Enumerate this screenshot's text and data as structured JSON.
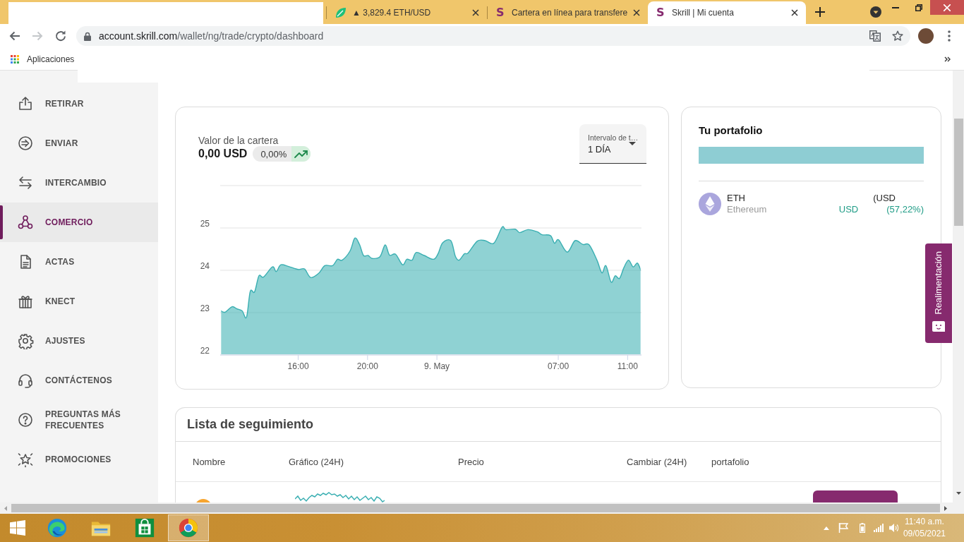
{
  "browser": {
    "tabs": [
      {
        "title": "▲ 3,829.4 ETH/USD",
        "selected": false
      },
      {
        "icon_letter": "S",
        "title": "Cartera en línea para transfere",
        "selected": false
      },
      {
        "icon_letter": "S",
        "title": "Skrill | Mi cuenta",
        "selected": true
      }
    ],
    "navigation": {
      "forward_disabled": true
    },
    "address": {
      "host": "account.skrill.com",
      "path": "/wallet/ng/trade/crypto/dashboard"
    },
    "bookmarks": [
      {
        "label": "Aplicaciones"
      }
    ]
  },
  "sidebar": {
    "items": [
      {
        "label": "RETIRAR",
        "selected": false
      },
      {
        "label": "ENVIAR",
        "selected": false
      },
      {
        "label": "INTERCAMBIO",
        "selected": false
      },
      {
        "label": "COMERCIO",
        "selected": true
      },
      {
        "label": "ACTAS",
        "selected": false
      },
      {
        "label": "KNECT",
        "selected": false
      },
      {
        "label": "AJUSTES",
        "selected": false
      },
      {
        "label": "CONTÁCTENOS",
        "selected": false
      },
      {
        "label": "PREGUNTAS MÁS FRECUENTES",
        "selected": false
      },
      {
        "label": "PROMOCIONES",
        "selected": false
      }
    ]
  },
  "portfolio_value": {
    "label": "Valor de la cartera",
    "amount": "0,00 USD",
    "change": "0,00%",
    "trend_up": true
  },
  "interval": {
    "label": "Intervalo de t…",
    "value": "1 DÍA"
  },
  "chart_data": {
    "type": "area",
    "grid": true,
    "x": [
      "2021-05-08T11:31",
      "2021-05-08T11:47",
      "2021-05-08T12:11",
      "2021-05-08T12:28",
      "2021-05-08T12:46",
      "2021-05-08T13:01",
      "2021-05-08T13:14",
      "2021-05-08T13:29",
      "2021-05-08T13:44",
      "2021-05-08T14:00",
      "2021-05-08T14:31",
      "2021-05-08T14:44",
      "2021-05-08T15:00",
      "2021-05-08T15:27",
      "2021-05-08T16:00",
      "2021-05-08T16:22",
      "2021-05-08T16:43",
      "2021-05-08T17:11",
      "2021-05-08T17:32",
      "2021-05-08T17:59",
      "2021-05-08T18:16",
      "2021-05-08T18:32",
      "2021-05-08T18:59",
      "2021-05-08T19:16",
      "2021-05-08T19:32",
      "2021-05-08T19:46",
      "2021-05-08T20:02",
      "2021-05-08T20:16",
      "2021-05-08T20:43",
      "2021-05-08T21:01",
      "2021-05-08T21:16",
      "2021-05-08T21:37",
      "2021-05-08T22:01",
      "2021-05-08T22:16",
      "2021-05-08T22:34",
      "2021-05-08T22:48",
      "2021-05-08T23:16",
      "2021-05-08T23:48",
      "2021-05-09T00:04",
      "2021-05-09T00:20",
      "2021-05-09T00:48",
      "2021-05-09T01:04",
      "2021-05-09T01:17",
      "2021-05-09T01:35",
      "2021-05-09T01:48",
      "2021-05-09T02:20",
      "2021-05-09T02:47",
      "2021-05-09T03:17",
      "2021-05-09T03:46",
      "2021-05-09T03:58",
      "2021-05-09T04:31",
      "2021-05-09T04:47",
      "2021-05-09T05:15",
      "2021-05-09T05:47",
      "2021-05-09T06:04",
      "2021-05-09T06:33",
      "2021-05-09T06:47",
      "2021-05-09T07:01",
      "2021-05-09T07:31",
      "2021-05-09T07:58",
      "2021-05-09T08:25",
      "2021-05-09T08:47",
      "2021-05-09T09:14",
      "2021-05-09T09:31",
      "2021-05-09T09:45",
      "2021-05-09T10:03",
      "2021-05-09T10:17",
      "2021-05-09T10:32",
      "2021-05-09T10:47",
      "2021-05-09T11:03",
      "2021-05-09T11:19",
      "2021-05-09T11:34",
      "2021-05-09T11:47"
    ],
    "series": [
      {
        "color": "#3aafb2",
        "values": [
          23.05,
          23.01,
          23.14,
          23.09,
          23.04,
          22.89,
          23.5,
          23.49,
          23.87,
          23.84,
          24.08,
          23.97,
          24.13,
          24.09,
          24.02,
          24.03,
          23.83,
          23.93,
          24.11,
          24.11,
          24.26,
          24.24,
          24.45,
          24.76,
          24.61,
          24.35,
          24.35,
          24.28,
          24.32,
          24.6,
          24.36,
          24.38,
          24.13,
          24.26,
          24.24,
          24.42,
          24.35,
          24.26,
          24.39,
          24.65,
          24.7,
          24.33,
          24.24,
          24.39,
          24.41,
          24.69,
          24.7,
          24.64,
          25.02,
          24.96,
          24.97,
          24.89,
          24.96,
          24.91,
          24.84,
          24.82,
          24.64,
          24.72,
          24.43,
          24.7,
          24.61,
          24.6,
          24.24,
          23.94,
          24.11,
          23.72,
          23.87,
          23.81,
          24.06,
          24.24,
          24.08,
          24.17,
          23.98
        ]
      }
    ],
    "xlim": [
      "2021-05-08T11:30",
      "2021-05-09T11:48"
    ],
    "ylim": [
      22,
      26
    ],
    "xticks": [
      {
        "value": "2021-05-08T16:00",
        "label": "16:00"
      },
      {
        "value": "2021-05-08T20:00",
        "label": "20:00"
      },
      {
        "value": "2021-05-09T00:00",
        "label": "9. May"
      },
      {
        "value": "2021-05-09T07:00",
        "label": "07:00"
      },
      {
        "value": "2021-05-09T11:00",
        "label": "11:00"
      }
    ],
    "yticks": [
      22,
      23,
      24,
      25
    ]
  },
  "portfolio": {
    "title": "Tu portafolio",
    "assets": [
      {
        "symbol": "ETH",
        "name": "Ethereum",
        "value": "(USD",
        "amount": "USD",
        "share": "(57,22%)"
      }
    ]
  },
  "feedback": {
    "label": "Realimentación"
  },
  "watchlist": {
    "title": "Lista de seguimiento",
    "columns": [
      "Nombre",
      "Gráfico (24H)",
      "Precio",
      "Cambiar (24H)",
      "portafolio"
    ]
  },
  "taskbar": {
    "apps": [
      {
        "selected": false
      },
      {
        "selected": false
      },
      {
        "selected": false
      },
      {
        "selected": true
      }
    ],
    "clock": {
      "time": "11:40 a.m.",
      "date": "09/05/2021"
    }
  }
}
